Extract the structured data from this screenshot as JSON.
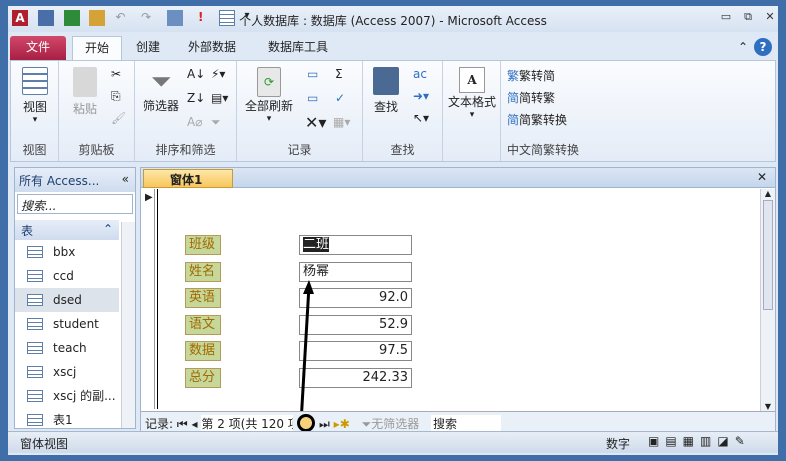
{
  "window": {
    "title": "个人数据库 : 数据库 (Access 2007) - Microsoft Access",
    "min": "▭",
    "restore": "⧉",
    "close": "✕"
  },
  "tabs": [
    "文件",
    "开始",
    "创建",
    "外部数据",
    "数据库工具"
  ],
  "ribbon": {
    "view": {
      "button": "视图",
      "group": "视图"
    },
    "clipboard": {
      "paste": "粘贴",
      "group": "剪贴板"
    },
    "sort": {
      "filter": "筛选器",
      "group": "排序和筛选"
    },
    "records": {
      "refresh": "全部刷新",
      "group": "记录"
    },
    "find": {
      "find": "查找",
      "group": "查找"
    },
    "text": {
      "format": "文本格式"
    },
    "chinese": {
      "t2s": "繁转简",
      "s2t": "简转繁",
      "convert": "简繁转换",
      "group": "中文简繁转换"
    }
  },
  "nav": {
    "title": "所有 Access...",
    "search_placeholder": "搜索...",
    "section": "表",
    "items": [
      "bbx",
      "ccd",
      "dsed",
      "student",
      "teach",
      "xscj",
      "xscj 的副...",
      "表1"
    ]
  },
  "form": {
    "tab": "窗体1",
    "fields": [
      {
        "label": "班级",
        "value": "二班"
      },
      {
        "label": "姓名",
        "value": "杨幂"
      },
      {
        "label": "英语",
        "value": "92.0"
      },
      {
        "label": "语文",
        "value": "52.9"
      },
      {
        "label": "数据",
        "value": "97.5"
      },
      {
        "label": "总分",
        "value": "242.33"
      }
    ]
  },
  "recordnav": {
    "label": "记录:",
    "current": "第 2 项(共 120 项)",
    "filter": "无筛选器",
    "search": "搜索"
  },
  "statusbar": {
    "left": "窗体视图",
    "mode": "数字"
  }
}
